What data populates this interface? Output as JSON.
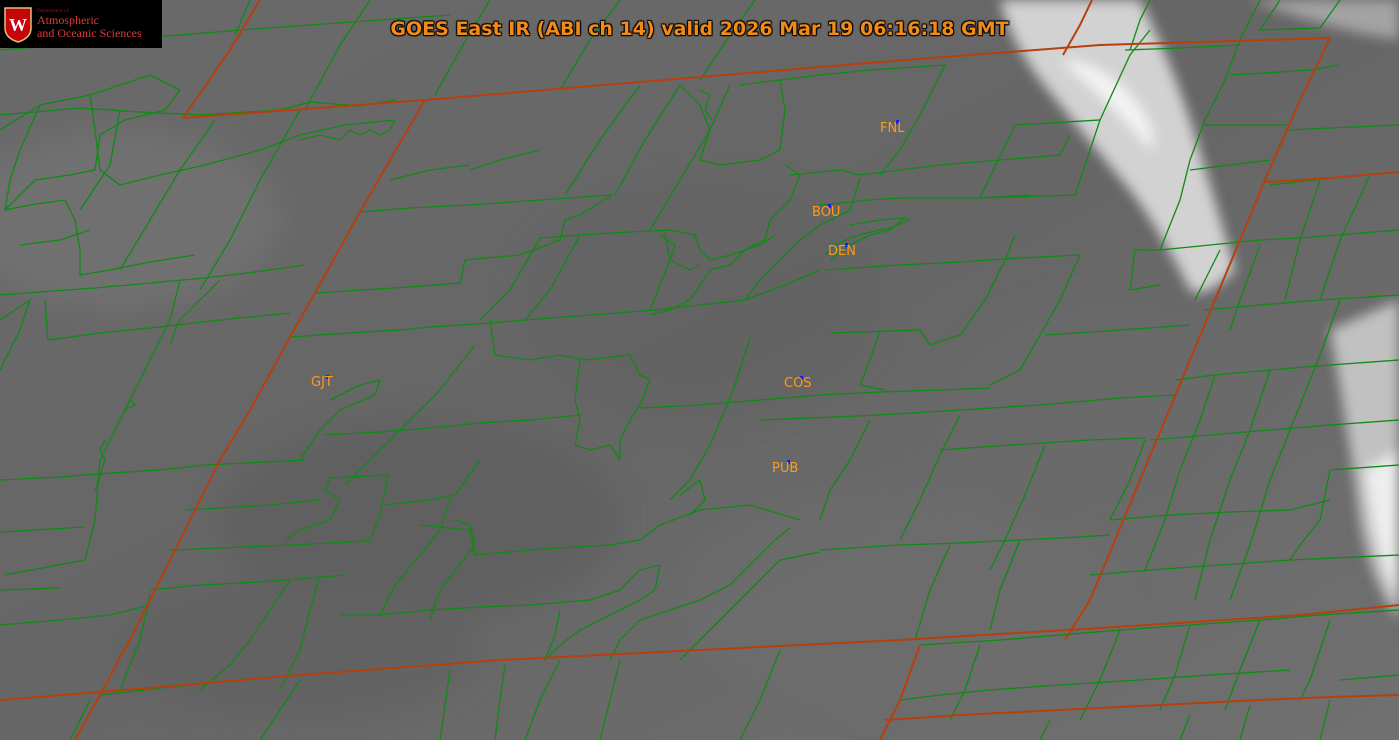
{
  "title": "GOES East IR (ABI ch 14) valid 2026 Mar 19 06:16:18 GMT",
  "logo": {
    "dept_line": "Department of",
    "line1": "Atmospheric",
    "line2": "and Oceanic Sciences",
    "crest_letter": "W"
  },
  "colors": {
    "state_border": "#b5400e",
    "county_border": "#0f8a14",
    "station_label": "#ff9a1a",
    "station_marker": "#1a1aff",
    "title": "#f28a1a",
    "logo_text": "#c5050c"
  },
  "stations": [
    {
      "id": "FNL",
      "icon": "station-marker-icon"
    },
    {
      "id": "BOU",
      "icon": "station-marker-icon"
    },
    {
      "id": "DEN",
      "icon": "station-marker-icon"
    },
    {
      "id": "GJT",
      "icon": "station-marker-icon"
    },
    {
      "id": "COS",
      "icon": "station-marker-icon"
    },
    {
      "id": "PUB",
      "icon": "station-marker-icon"
    }
  ]
}
